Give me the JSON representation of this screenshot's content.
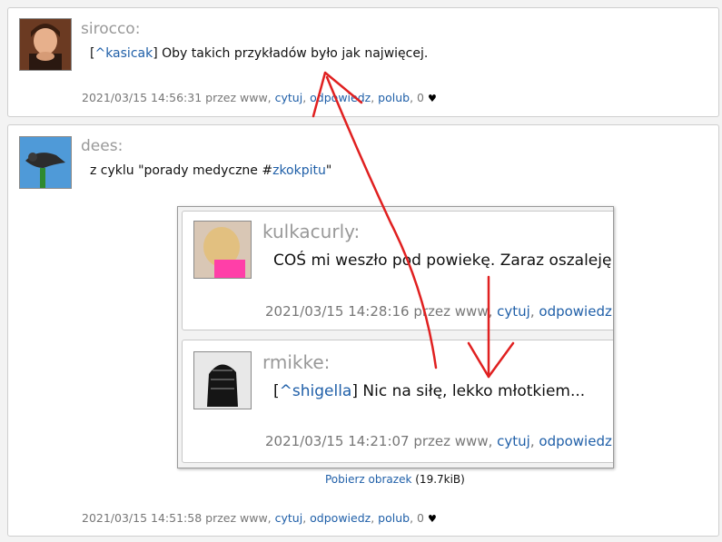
{
  "post1": {
    "author": "sirocco:",
    "mention": "^kasicak",
    "text": " Oby takich przykładów było jak najwięcej.",
    "meta_date": "2021/03/15 14:56:31 przez www,",
    "quote_label": "cytuj",
    "reply_label": "odpowiedz",
    "like_label": "polub",
    "likes": "0",
    "heart": "♥"
  },
  "post2": {
    "author": "dees:",
    "text_before": "z cyklu \"porady medyczne #",
    "hashtag": "zkokpitu",
    "text_after": "\"",
    "meta_date": "2021/03/15 14:51:58 przez www,",
    "quote_label": "cytuj",
    "reply_label": "odpowiedz",
    "like_label": "polub",
    "likes": "0",
    "heart": "♥",
    "image": {
      "download_label": "Pobierz obrazek",
      "size": "(19.7kiB)",
      "comments": [
        {
          "author": "kulkacurly:",
          "text": "COŚ mi weszło pod powiekę. Zaraz oszaleję.",
          "meta_date": "2021/03/15 14:28:16 przez www,",
          "quote_label": "cytuj",
          "reply_label": "odpowiedz"
        },
        {
          "author": "rmikke:",
          "mention": "^shigella",
          "text": " Nic na siłę, lekko młotkiem...",
          "meta_date": "2021/03/15 14:21:07 przez www,",
          "quote_label": "cytuj",
          "reply_label": "odpowiedz"
        }
      ]
    }
  },
  "colors": {
    "link": "#1f5fa8",
    "annotation": "#e02020",
    "author": "#999999"
  }
}
